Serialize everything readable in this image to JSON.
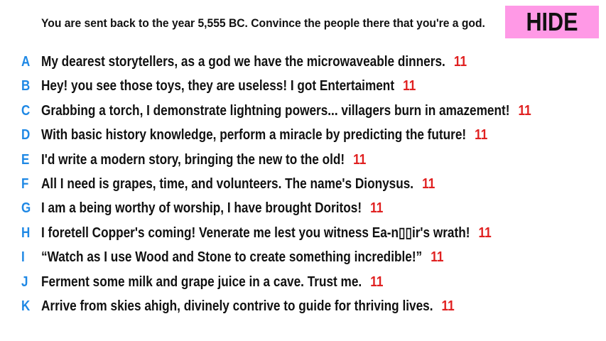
{
  "question": {
    "prompt": "You are sent back to the year 5,555 BC. Convince the people there that you're a god."
  },
  "hide_button": {
    "label": "HIDE",
    "color": "#ff99e6"
  },
  "colors": {
    "letter": "#1e88e5",
    "score": "#e02020",
    "text": "#111111"
  },
  "answers": [
    {
      "letter": "A",
      "text": "My dearest storytellers, as a god we have the microwaveable dinners.",
      "score": "11"
    },
    {
      "letter": "B",
      "text": "Hey! you see those toys, they are useless! I got Entertaiment",
      "score": "11"
    },
    {
      "letter": "C",
      "text": "Grabbing a torch, I demonstrate lightning powers... villagers burn in amazement!",
      "score": "11"
    },
    {
      "letter": "D",
      "text": "With basic history knowledge, perform a miracle by predicting the future!",
      "score": "11"
    },
    {
      "letter": "E",
      "text": "I'd write a modern story, bringing the new to the old!",
      "score": "11"
    },
    {
      "letter": "F",
      "text": "All I need is grapes, time, and volunteers. The name's Dionysus.",
      "score": "11"
    },
    {
      "letter": "G",
      "text": "I am a being worthy of worship, I have brought Doritos!",
      "score": "11"
    },
    {
      "letter": "H",
      "text": "I foretell Copper's coming! Venerate me lest you witness Ea-n▯▯ir's wrath!",
      "score": "11"
    },
    {
      "letter": "I",
      "text": "“Watch as I use Wood and Stone to create something incredible!”",
      "score": "11"
    },
    {
      "letter": "J",
      "text": "Ferment some milk and grape juice in a cave. Trust me.",
      "score": "11"
    },
    {
      "letter": "K",
      "text": "Arrive from skies ahigh, divinely contrive to guide for thriving lives.",
      "score": "11"
    }
  ]
}
